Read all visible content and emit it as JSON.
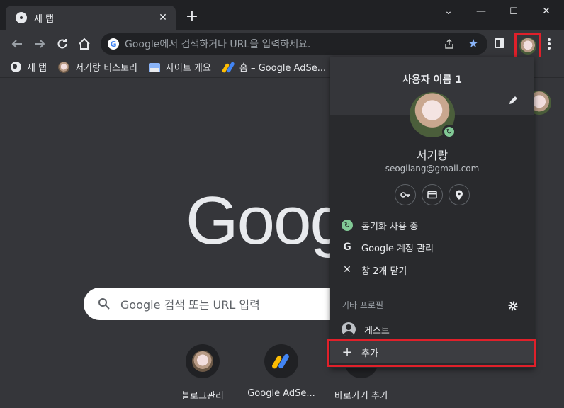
{
  "tab": {
    "title": "새 탭",
    "close": "✕",
    "new_tab": "+"
  },
  "window": {
    "minimize": "—",
    "maximize": "☐",
    "close": "✕",
    "chevron": "⌄"
  },
  "omnibox": {
    "placeholder": "Google에서 검색하거나 URL을 입력하세요."
  },
  "bookmarks": [
    {
      "label": "새 탭",
      "icon": "globe-icon"
    },
    {
      "label": "서기랑 티스토리",
      "icon": "avatar"
    },
    {
      "label": "사이트 개요",
      "icon": "site-icon"
    },
    {
      "label": "홈 – Google AdSe...",
      "icon": "adsense-icon"
    }
  ],
  "ntp": {
    "logo": "Goog",
    "search_placeholder": "Google 검색 또는 URL 입력",
    "shortcuts": [
      {
        "label": "블로그관리"
      },
      {
        "label": "Google AdSe..."
      },
      {
        "label": "바로가기 추가"
      }
    ]
  },
  "profile_panel": {
    "title": "사용자 이름 1",
    "name": "서기랑",
    "email": "seogilang@gmail.com",
    "items": {
      "sync": "동기화 사용 중",
      "manage": "Google 계정 관리",
      "close_windows": "창 2개 닫기"
    },
    "other_profiles_label": "기타 프로필",
    "guest": "게스트",
    "add": "추가"
  },
  "colors": {
    "accent_blue": "#8ab4f8",
    "sync_green": "#81c995",
    "highlight_red": "#e0202a",
    "background": "#35363a"
  }
}
